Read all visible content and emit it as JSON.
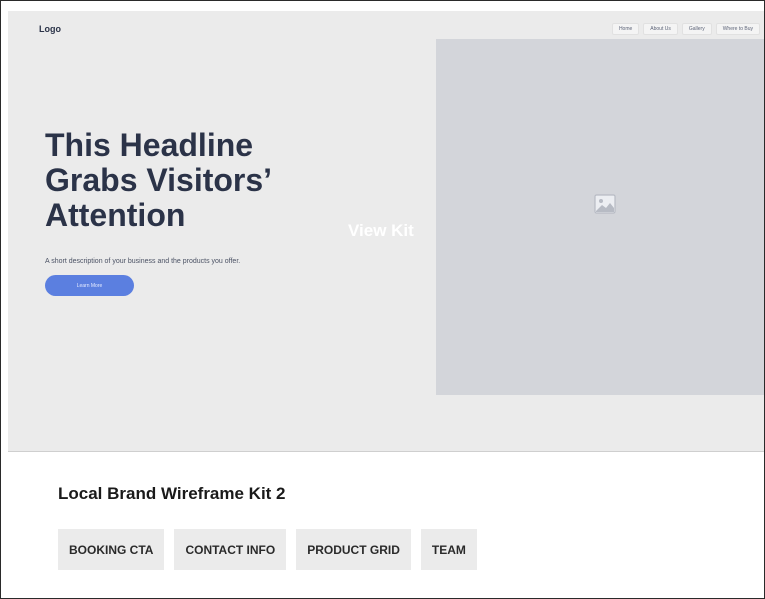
{
  "preview": {
    "logo": "Logo",
    "nav": [
      "Home",
      "About Us",
      "Gallery",
      "Where to Buy"
    ],
    "headline": "This Headline Grabs Visitors’ Attention",
    "description": "A short description of your business and the products you offer.",
    "cta_label": "Learn More",
    "image_icon": "image-placeholder-icon"
  },
  "overlay": {
    "view_kit": "View Kit"
  },
  "kit": {
    "title": "Local Brand Wireframe Kit 2",
    "tags": [
      "BOOKING CTA",
      "CONTACT INFO",
      "PRODUCT GRID",
      "TEAM"
    ]
  },
  "colors": {
    "preview_bg": "#ebebeb",
    "headline": "#2b3348",
    "button": "#5b7fe0",
    "image_placeholder": "#d3d5da",
    "tag_bg": "#ebebeb"
  }
}
